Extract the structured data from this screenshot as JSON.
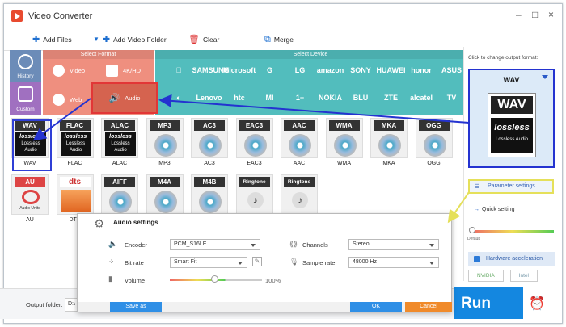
{
  "app": {
    "title": "Video Converter"
  },
  "window_controls": {
    "minimize": "–",
    "maximize": "□",
    "close": "×"
  },
  "toolbar": {
    "add_files": "Add Files",
    "add_video_folder": "Add Video Folder",
    "clear": "Clear",
    "merge": "Merge"
  },
  "sidebar": {
    "history": "History",
    "custom": "Custom"
  },
  "format_section": {
    "header": "Select Format",
    "items": [
      "Video",
      "4K/HD",
      "Web",
      "Audio"
    ]
  },
  "device_section": {
    "header": "Select Device",
    "row1": [
      "",
      "SAMSUNG",
      "Microsoft",
      "G",
      "LG",
      "amazon",
      "SONY",
      "HUAWEI",
      "honor",
      "ASUS"
    ],
    "row2": [
      "◐",
      "Lenovo",
      "htc",
      "MI",
      "1+",
      "NOKIA",
      "BLU",
      "ZTE",
      "alcatel",
      "TV"
    ]
  },
  "formats_row1": [
    {
      "badge": "WAV",
      "label": "WAV",
      "kind": "lossless"
    },
    {
      "badge": "FLAC",
      "label": "FLAC",
      "kind": "lossless"
    },
    {
      "badge": "ALAC",
      "label": "ALAC",
      "kind": "lossless"
    },
    {
      "badge": "MP3",
      "label": "MP3",
      "kind": "disc"
    },
    {
      "badge": "AC3",
      "label": "AC3",
      "kind": "disc"
    },
    {
      "badge": "EAC3",
      "label": "EAC3",
      "kind": "disc"
    },
    {
      "badge": "AAC",
      "label": "AAC",
      "kind": "disc"
    },
    {
      "badge": "WMA",
      "label": "WMA",
      "kind": "disc"
    },
    {
      "badge": "MKA",
      "label": "MKA",
      "kind": "disc"
    },
    {
      "badge": "OGG",
      "label": "OGG",
      "kind": "disc"
    }
  ],
  "formats_row2": [
    {
      "badge": "AU",
      "label": "AU",
      "kind": "units"
    },
    {
      "badge": "dts",
      "label": "DTS",
      "kind": "dts"
    },
    {
      "badge": "AIFF",
      "label": "",
      "kind": "disc"
    },
    {
      "badge": "M4A",
      "label": "",
      "kind": "disc"
    },
    {
      "badge": "M4B",
      "label": "",
      "kind": "disc"
    },
    {
      "badge": "Ringtone",
      "label": "",
      "kind": "ringtone"
    },
    {
      "badge": "Ringtone",
      "label": "",
      "kind": "ringtone"
    }
  ],
  "lossless_text": {
    "big": "lossless",
    "small": "Lossless Audio",
    "units": "Audio Units"
  },
  "right_panel": {
    "hint": "Click to change output format:",
    "selected_format": "WAV",
    "output_badge": "WAV",
    "output_lossless": "lossless",
    "output_lossless_small": "Lossless Audio",
    "parameter_settings": "Parameter settings",
    "quick_setting": "Quick setting",
    "default_label": "Default",
    "hardware_acceleration": "Hardware acceleration",
    "chips": [
      "NVIDIA",
      "Intel"
    ]
  },
  "bottom": {
    "output_folder_label": "Output folder:",
    "output_folder_value": "D:\\",
    "run": "Run"
  },
  "dialog": {
    "title": "Audio settings",
    "encoder_label": "Encoder",
    "encoder_value": "PCM_S16LE",
    "bitrate_label": "Bit rate",
    "bitrate_value": "Smart Fit",
    "volume_label": "Volume",
    "volume_value": "100%",
    "volume_level": 1.0,
    "channels_label": "Channels",
    "channels_value": "Stereo",
    "samplerate_label": "Sample rate",
    "samplerate_value": "48000 Hz",
    "save_as": "Save as",
    "ok": "OK",
    "cancel": "Cancel"
  },
  "colors": {
    "accent_blue": "#1487e0",
    "highlight_red": "#e23636",
    "highlight_blue": "#2433d0",
    "highlight_yellow": "#e5e05a"
  }
}
